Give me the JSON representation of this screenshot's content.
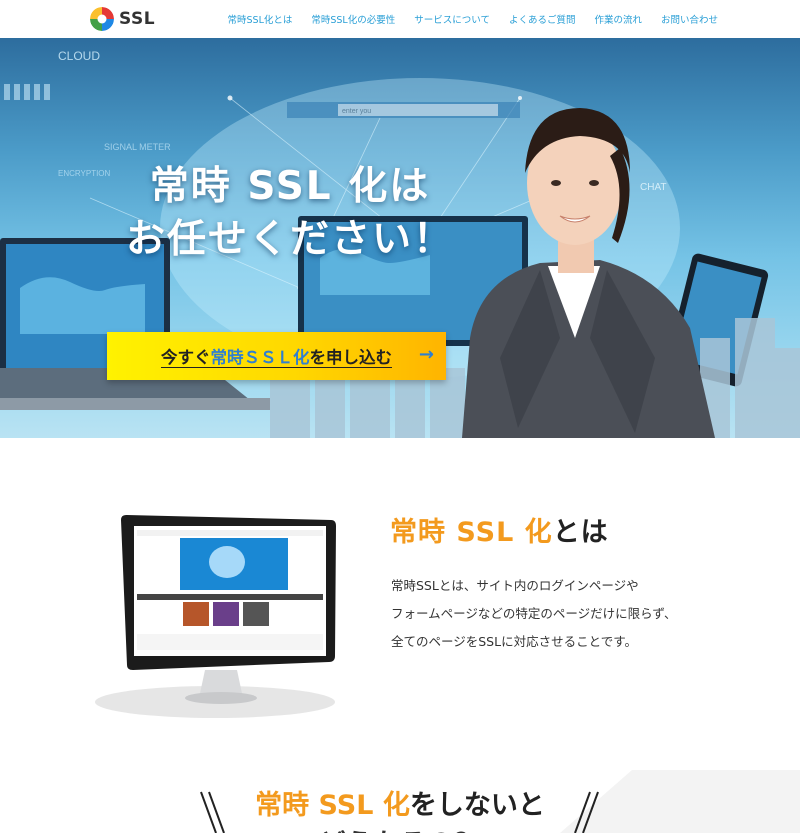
{
  "header": {
    "logo_text": "SSL",
    "nav": [
      "常時SSL化とは",
      "常時SSL化の必要性",
      "サービスについて",
      "よくあるご質問",
      "作業の流れ",
      "お問い合わせ"
    ]
  },
  "hero": {
    "title_line1": "常時 SSL 化は",
    "title_line2": "お任せください！",
    "cta_before": "今すぐ",
    "cta_highlight": "常時ＳＳＬ化",
    "cta_after": "を申し込む",
    "cta_arrow": "→",
    "bg_labels": [
      "CLOUD",
      "SIGNAL METER",
      "ENCRYPTION",
      "CHAT"
    ],
    "search_placeholder": "enter you"
  },
  "about": {
    "title_highlight": "常時 SSL 化",
    "title_rest": "とは",
    "lines": [
      "常時SSLとは、サイト内のログインページや",
      "フォームページなどの特定のページだけに限らず、",
      "全てのページをSSLに対応させることです。"
    ]
  },
  "bottom": {
    "title_highlight": "常時 SSL 化",
    "title_rest": "をしないと",
    "title_line2": "どうなるの？"
  },
  "colors": {
    "accent_orange": "#f39a1e",
    "nav_blue": "#2a9fd6",
    "cta_yellow": "#ffd800"
  }
}
